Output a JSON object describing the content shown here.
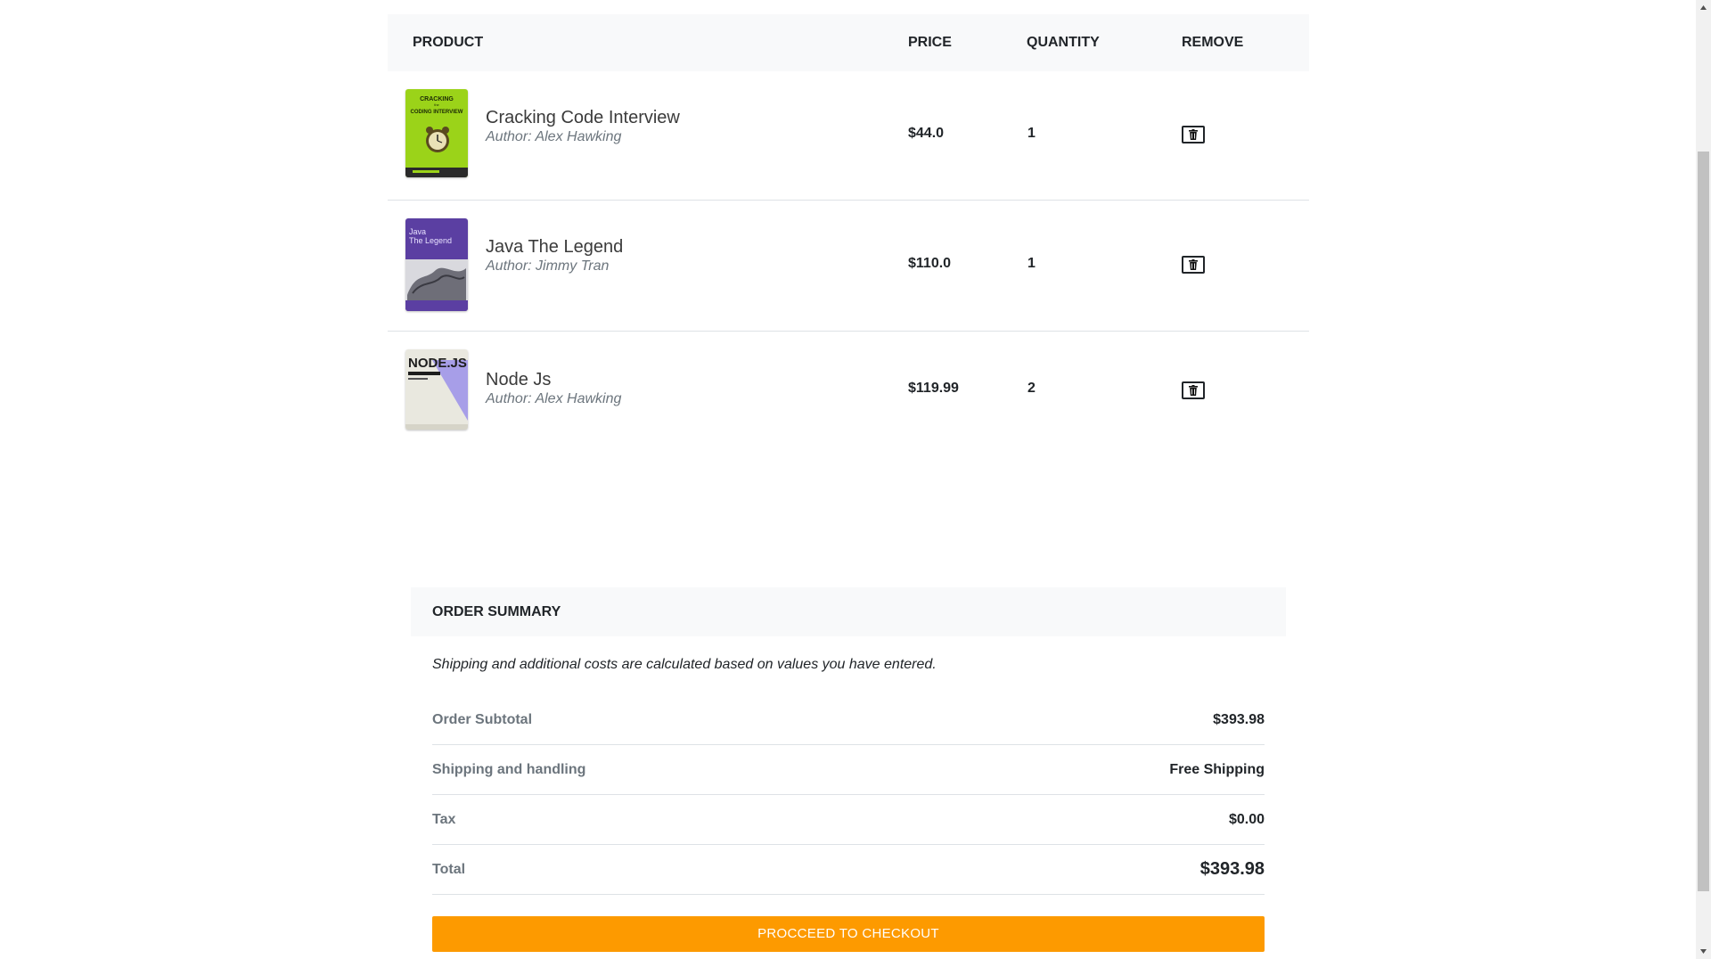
{
  "cart": {
    "headers": {
      "product": "Product",
      "price": "Price",
      "quantity": "Quantity",
      "remove": "Remove"
    },
    "items": [
      {
        "title": "Cracking Code Interview",
        "author": "Author: Alex Hawking",
        "price": "$44.0",
        "quantity": "1",
        "cover_lines": [
          "CRACKING",
          "the",
          "CODING INTERVIEW"
        ],
        "cover_color": "#9bd319"
      },
      {
        "title": "Java The Legend",
        "author": "Author: Jimmy Tran",
        "price": "$110.0",
        "quantity": "1",
        "cover_lines": [
          "Java",
          "The Legend"
        ],
        "cover_color": "#5b3fa2"
      },
      {
        "title": "Node Js",
        "author": "Author: Alex Hawking",
        "price": "$119.99",
        "quantity": "2",
        "cover_lines": [
          "NODE.JS"
        ],
        "cover_color": "#a79ee8"
      }
    ]
  },
  "summary": {
    "title": "Order summary",
    "note": "Shipping and additional costs are calculated based on values you have entered.",
    "rows": [
      {
        "label": "Order Subtotal",
        "value": "$393.98"
      },
      {
        "label": "Shipping and handling",
        "value": "Free Shipping"
      },
      {
        "label": "Tax",
        "value": "$0.00"
      },
      {
        "label": "Total",
        "value": "$393.98"
      }
    ],
    "checkout_label": "Procceed to checkout"
  },
  "colors": {
    "checkout_button": "#fd9a00",
    "header_background": "#f8f9fa"
  }
}
